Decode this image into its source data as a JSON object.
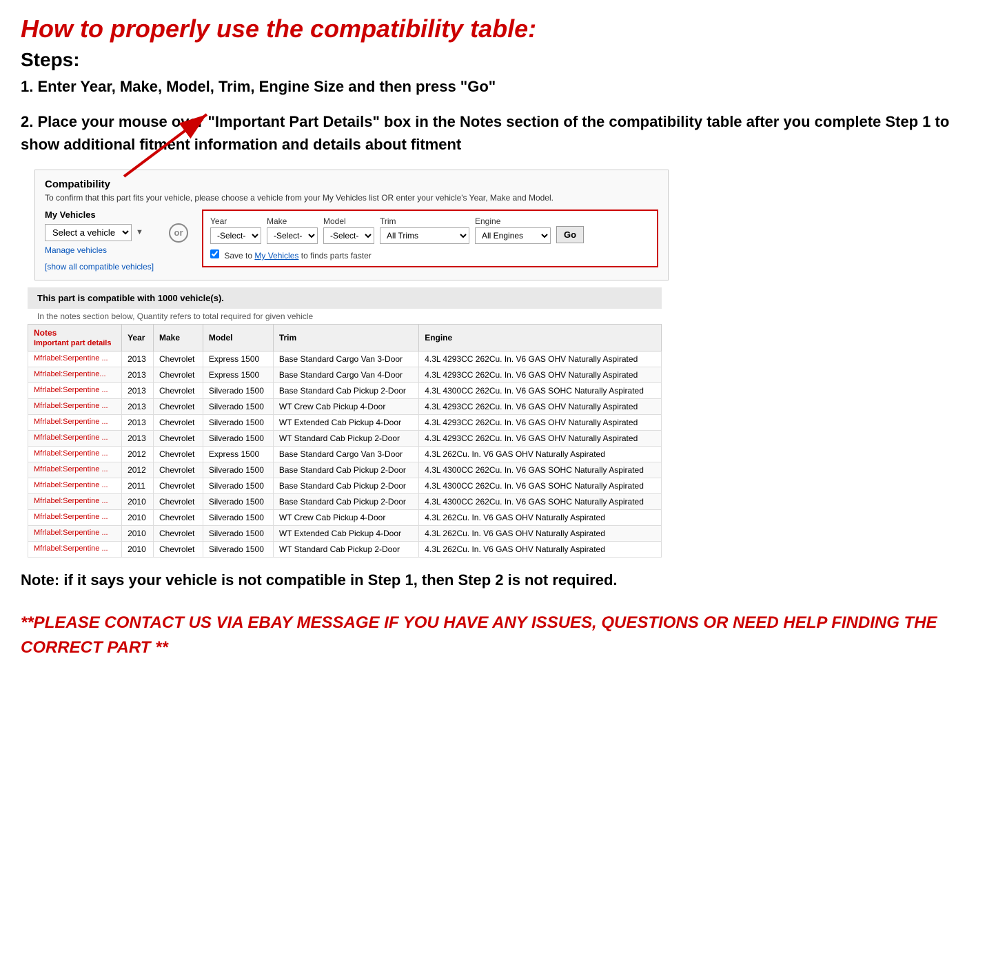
{
  "title": "How to properly use the compatibility table:",
  "steps_heading": "Steps:",
  "step1": "1. Enter Year, Make, Model, Trim, Engine Size and then press \"Go\"",
  "step2": "2. Place your mouse over \"Important Part Details\" box in the Notes section of the compatibility table after you complete Step 1 to show additional fitment information and details about fitment",
  "compatibility": {
    "section_title": "Compatibility",
    "desc": "To confirm that this part fits your vehicle, please choose a vehicle from your My Vehicles list OR enter your vehicle's Year, Make and Model.",
    "my_vehicles_label": "My Vehicles",
    "select_vehicle_placeholder": "Select a vehicle",
    "manage_vehicles": "Manage vehicles",
    "show_all": "[show all compatible vehicles]",
    "or_label": "or",
    "year_label": "Year",
    "year_placeholder": "-Select-",
    "make_label": "Make",
    "make_placeholder": "-Select-",
    "model_label": "Model",
    "model_placeholder": "-Select-",
    "trim_label": "Trim",
    "trim_value": "All Trims",
    "engine_label": "Engine",
    "engine_value": "All Engines",
    "go_button": "Go",
    "save_text": "Save to My Vehicles to finds parts faster",
    "info_bar": "This part is compatible with 1000 vehicle(s).",
    "quantity_note": "In the notes section below, Quantity refers to total required for given vehicle",
    "table_headers": [
      "Notes\nImportant part details",
      "Year",
      "Make",
      "Model",
      "Trim",
      "Engine"
    ],
    "table_rows": [
      {
        "notes": "Mfrlabel:Serpentine ...",
        "year": "2013",
        "make": "Chevrolet",
        "model": "Express 1500",
        "trim": "Base Standard Cargo Van 3-Door",
        "engine": "4.3L 4293CC 262Cu. In. V6 GAS OHV Naturally Aspirated"
      },
      {
        "notes": "Mfrlabel:Serpentine...",
        "year": "2013",
        "make": "Chevrolet",
        "model": "Express 1500",
        "trim": "Base Standard Cargo Van 4-Door",
        "engine": "4.3L 4293CC 262Cu. In. V6 GAS OHV Naturally Aspirated"
      },
      {
        "notes": "Mfrlabel:Serpentine ...",
        "year": "2013",
        "make": "Chevrolet",
        "model": "Silverado 1500",
        "trim": "Base Standard Cab Pickup 2-Door",
        "engine": "4.3L 4300CC 262Cu. In. V6 GAS SOHC Naturally Aspirated"
      },
      {
        "notes": "Mfrlabel:Serpentine ...",
        "year": "2013",
        "make": "Chevrolet",
        "model": "Silverado 1500",
        "trim": "WT Crew Cab Pickup 4-Door",
        "engine": "4.3L 4293CC 262Cu. In. V6 GAS OHV Naturally Aspirated"
      },
      {
        "notes": "Mfrlabel:Serpentine ...",
        "year": "2013",
        "make": "Chevrolet",
        "model": "Silverado 1500",
        "trim": "WT Extended Cab Pickup 4-Door",
        "engine": "4.3L 4293CC 262Cu. In. V6 GAS OHV Naturally Aspirated"
      },
      {
        "notes": "Mfrlabel:Serpentine ...",
        "year": "2013",
        "make": "Chevrolet",
        "model": "Silverado 1500",
        "trim": "WT Standard Cab Pickup 2-Door",
        "engine": "4.3L 4293CC 262Cu. In. V6 GAS OHV Naturally Aspirated"
      },
      {
        "notes": "Mfrlabel:Serpentine ...",
        "year": "2012",
        "make": "Chevrolet",
        "model": "Express 1500",
        "trim": "Base Standard Cargo Van 3-Door",
        "engine": "4.3L 262Cu. In. V6 GAS OHV Naturally Aspirated"
      },
      {
        "notes": "Mfrlabel:Serpentine ...",
        "year": "2012",
        "make": "Chevrolet",
        "model": "Silverado 1500",
        "trim": "Base Standard Cab Pickup 2-Door",
        "engine": "4.3L 4300CC 262Cu. In. V6 GAS SOHC Naturally Aspirated"
      },
      {
        "notes": "Mfrlabel:Serpentine ...",
        "year": "2011",
        "make": "Chevrolet",
        "model": "Silverado 1500",
        "trim": "Base Standard Cab Pickup 2-Door",
        "engine": "4.3L 4300CC 262Cu. In. V6 GAS SOHC Naturally Aspirated"
      },
      {
        "notes": "Mfrlabel:Serpentine ...",
        "year": "2010",
        "make": "Chevrolet",
        "model": "Silverado 1500",
        "trim": "Base Standard Cab Pickup 2-Door",
        "engine": "4.3L 4300CC 262Cu. In. V6 GAS SOHC Naturally Aspirated"
      },
      {
        "notes": "Mfrlabel:Serpentine ...",
        "year": "2010",
        "make": "Chevrolet",
        "model": "Silverado 1500",
        "trim": "WT Crew Cab Pickup 4-Door",
        "engine": "4.3L 262Cu. In. V6 GAS OHV Naturally Aspirated"
      },
      {
        "notes": "Mfrlabel:Serpentine ...",
        "year": "2010",
        "make": "Chevrolet",
        "model": "Silverado 1500",
        "trim": "WT Extended Cab Pickup 4-Door",
        "engine": "4.3L 262Cu. In. V6 GAS OHV Naturally Aspirated"
      },
      {
        "notes": "Mfrlabel:Serpentine ...",
        "year": "2010",
        "make": "Chevrolet",
        "model": "Silverado 1500",
        "trim": "WT Standard Cab Pickup 2-Door",
        "engine": "4.3L 262Cu. In. V6 GAS OHV Naturally Aspirated"
      }
    ]
  },
  "note_text": "Note: if it says your vehicle is not compatible in Step 1, then Step 2 is not required.",
  "contact_text": "**PLEASE CONTACT US VIA EBAY MESSAGE IF YOU HAVE ANY ISSUES, QUESTIONS OR NEED HELP FINDING THE CORRECT PART **"
}
